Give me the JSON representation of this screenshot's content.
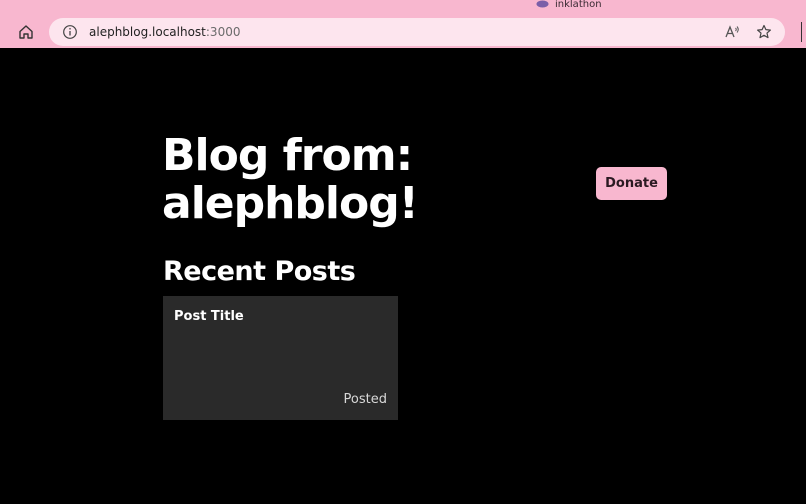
{
  "browser": {
    "profile_name": "inklathon",
    "url_host": "alephblog.localhost",
    "url_port": ":3000"
  },
  "page": {
    "title_line1": "Blog from:",
    "title_line2": "alephblog!",
    "donate_label": "Donate",
    "recent_heading": "Recent Posts",
    "posts": [
      {
        "title": "Post Title",
        "status": "Posted"
      }
    ]
  },
  "colors": {
    "accent_pink": "#f8b7cf",
    "address_bar": "#fde5ee",
    "page_background": "#000000",
    "card_background": "#2a2a2a"
  },
  "icons": {
    "home": "home-icon",
    "info": "info-icon",
    "read_aloud": "read-aloud-icon",
    "favorite": "star-icon",
    "profile": "profile-icon"
  }
}
